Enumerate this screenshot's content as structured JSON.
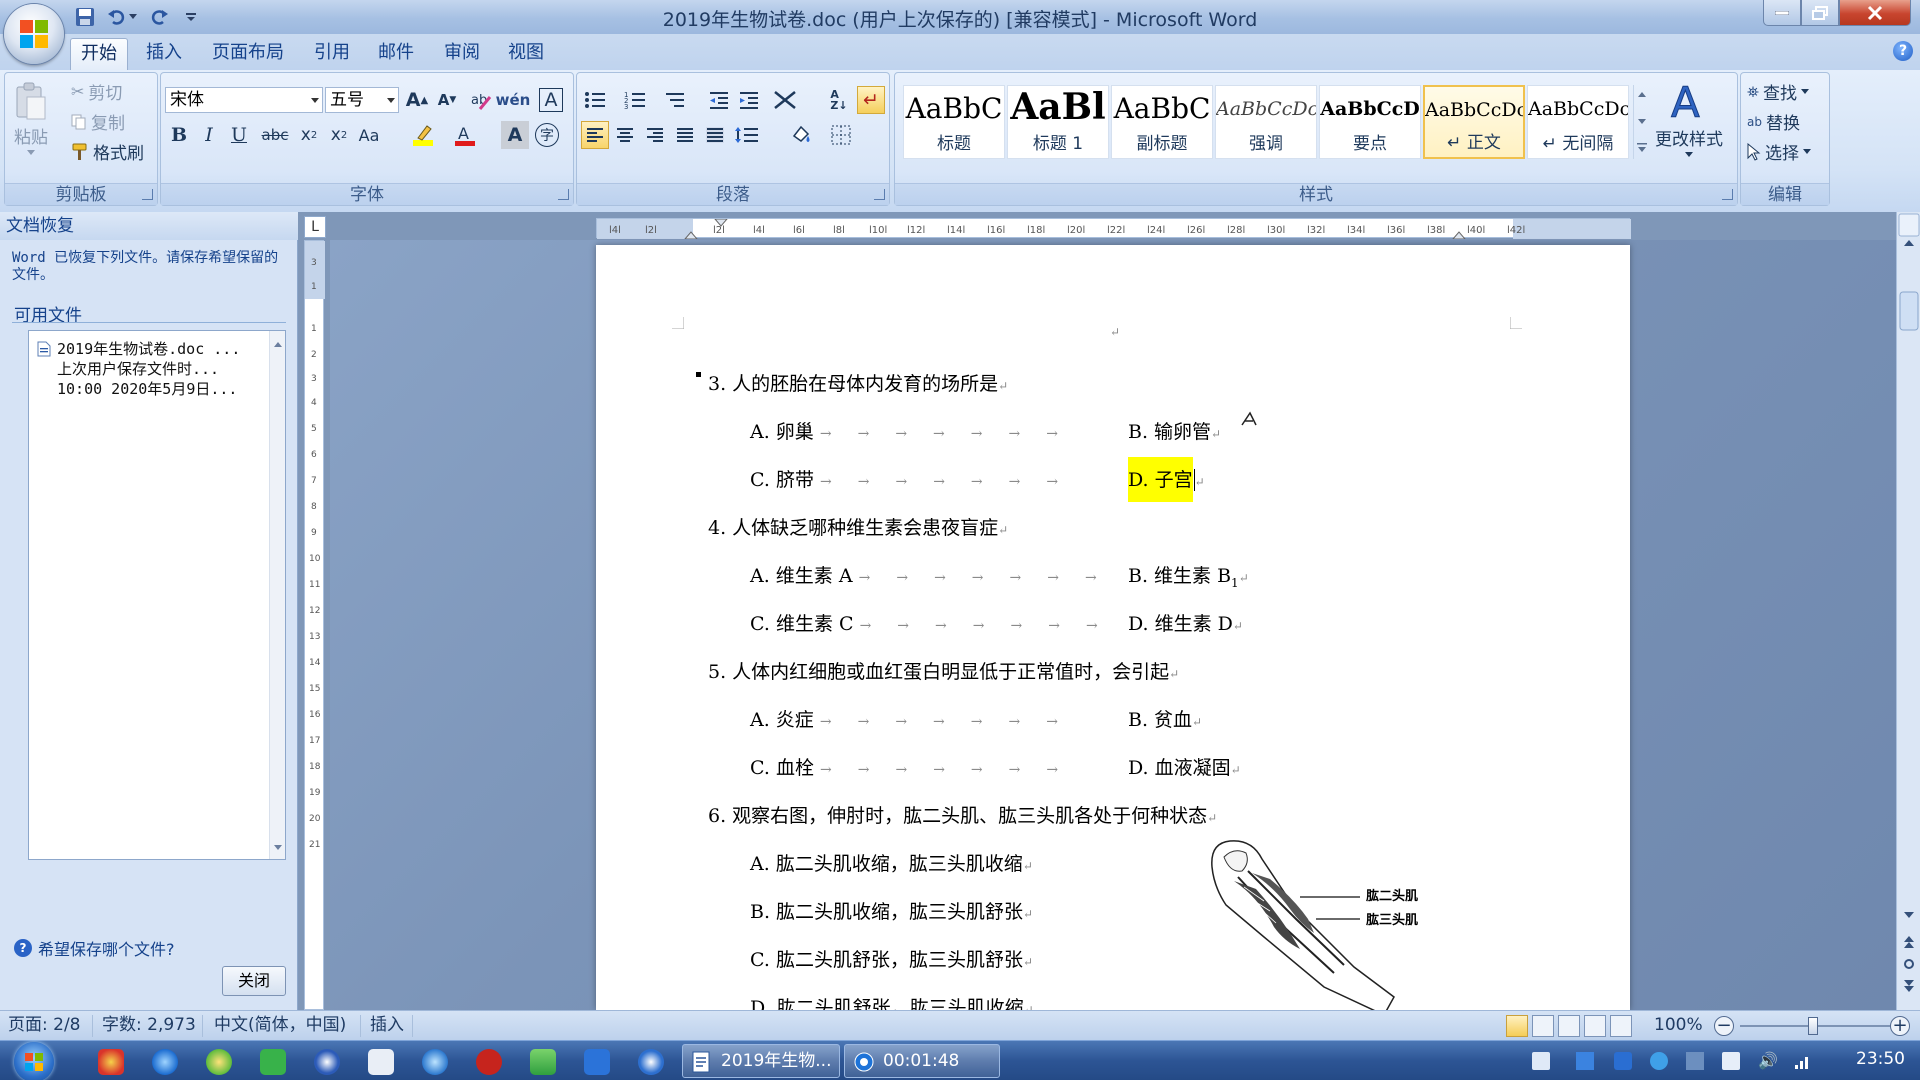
{
  "window": {
    "title": "2019年生物试卷.doc (用户上次保存的) [兼容模式] - Microsoft Word"
  },
  "tabs": [
    "开始",
    "插入",
    "页面布局",
    "引用",
    "邮件",
    "审阅",
    "视图"
  ],
  "clipboard": {
    "paste": "粘贴",
    "cut": "剪切",
    "copy": "复制",
    "format_painter": "格式刷",
    "label": "剪贴板"
  },
  "font": {
    "name": "宋体",
    "size": "五号",
    "label": "字体"
  },
  "paragraph": {
    "label": "段落"
  },
  "styles": {
    "items": [
      {
        "sample": "AaBbC",
        "name": "标题"
      },
      {
        "sample": "AaBl",
        "name": "标题 1"
      },
      {
        "sample": "AaBbC",
        "name": "副标题"
      },
      {
        "sample": "AaBbCcDc",
        "name": "强调"
      },
      {
        "sample": "AaBbCcD",
        "name": "要点"
      },
      {
        "sample": "AaBbCcDc",
        "name": "↵ 正文"
      },
      {
        "sample": "AaBbCcDc",
        "name": "↵ 无间隔"
      }
    ],
    "change_styles": "更改样式",
    "label": "样式"
  },
  "editing": {
    "find": "查找",
    "replace": "替换",
    "select": "选择",
    "label": "编辑"
  },
  "recovery": {
    "title": "文档恢复",
    "message": "Word 已恢复下列文件。请保存希望保留的文件。",
    "available": "可用文件",
    "file_line1": "2019年生物试卷.doc ...",
    "file_line2": "上次用户保存文件时...",
    "file_line3": "10:00 2020年5月9日...",
    "question": "希望保存哪个文件?",
    "close": "关闭"
  },
  "ruler_corner": "L",
  "document": {
    "q3": "3. 人的胚胎在母体内发育的场所是",
    "q3a": "A. 卵巢",
    "q3b": "B. 输卵管",
    "q3c": "C. 脐带",
    "q3d": "D. 子宫",
    "q4": "4. 人体缺乏哪种维生素会患夜盲症",
    "q4a": "A. 维生素 A",
    "q4b": "B. 维生素 B",
    "q4b_sub": "1",
    "q4c": "C. 维生素 C",
    "q4d": "D. 维生素 D",
    "q5": "5. 人体内红细胞或血红蛋白明显低于正常值时，会引起",
    "q5a": "A. 炎症",
    "q5b": "B. 贫血",
    "q5c": "C. 血栓",
    "q5d": "D. 血液凝固",
    "q6": "6. 观察右图，伸肘时，肱二头肌、肱三头肌各处于何种状态",
    "q6a": "A. 肱二头肌收缩，肱三头肌收缩",
    "q6b": "B. 肱二头肌收缩，肱三头肌舒张",
    "q6c": "C. 肱二头肌舒张，肱三头肌舒张",
    "q6d": "D. 肱二头肌舒张，肱三头肌收缩",
    "fig_label1": "肱二头肌",
    "fig_label2": "肱三头肌",
    "para_mark": "↵",
    "tab_arrows": "→→→→→→→"
  },
  "status": {
    "page": "页面: 2/8",
    "words": "字数: 2,973",
    "language": "中文(简体，中国)",
    "mode": "插入",
    "zoom": "100%"
  },
  "taskbar": {
    "task1": "2019年生物...",
    "task2": "00:01:48",
    "clock": "23:50"
  }
}
